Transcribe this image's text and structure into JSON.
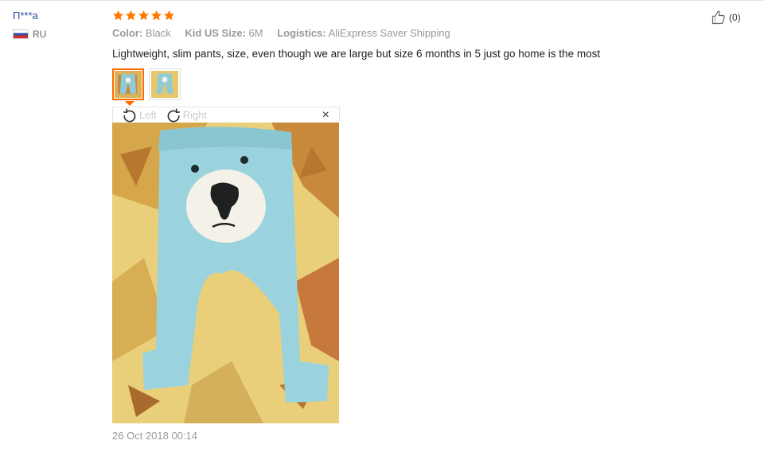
{
  "review": {
    "user": {
      "name": "П***а",
      "country": "RU"
    },
    "rating_stars": 5,
    "attributes": [
      {
        "key": "Color:",
        "value": "Black"
      },
      {
        "key": "Kid US Size:",
        "value": "6M"
      },
      {
        "key": "Logistics:",
        "value": "AliExpress Saver Shipping"
      }
    ],
    "text": "Lightweight, slim pants, size, even though we are large but size 6 months in 5 just go home is the most",
    "viewer": {
      "rotate_left": "Left",
      "rotate_right": "Right",
      "close": "×"
    },
    "date": "26 Oct 2018 00:14",
    "helpful_count": "(0)"
  },
  "colors": {
    "star": "#ff7a00",
    "user_link": "#2a4e9c",
    "active_thumb": "#ff6a00",
    "muted": "#999999"
  },
  "icons": [
    "flag-ru-icon",
    "star-icon",
    "rotate-left-icon",
    "rotate-right-icon",
    "close-icon",
    "thumbs-up-icon"
  ]
}
